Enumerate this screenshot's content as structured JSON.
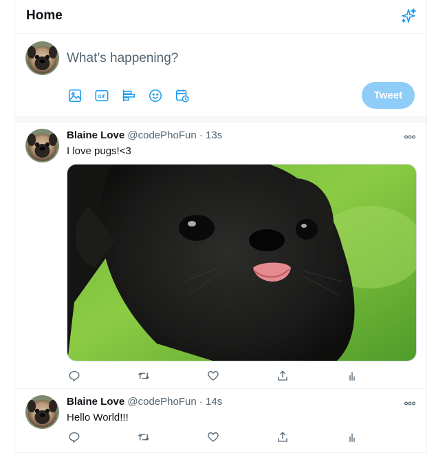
{
  "header": {
    "title": "Home",
    "sparkle_icon": "sparkle-icon"
  },
  "composer": {
    "placeholder": "What’s happening?",
    "tools": [
      "image-icon",
      "gif-icon",
      "poll-icon",
      "emoji-icon",
      "schedule-icon"
    ],
    "tweet_label": "Tweet"
  },
  "tweets": [
    {
      "name": "Blaine Love",
      "handle": "@codePhoFun",
      "dot": "·",
      "time": "13s",
      "text": "I love pugs!<3",
      "has_media": true
    },
    {
      "name": "Blaine Love",
      "handle": "@codePhoFun",
      "dot": "·",
      "time": "14s",
      "text": "Hello World!!!",
      "has_media": false
    }
  ],
  "colors": {
    "accent": "#1d9bf0",
    "tweet_button_disabled": "#8ecdf8",
    "muted": "#536471",
    "border": "#eff3f4"
  }
}
